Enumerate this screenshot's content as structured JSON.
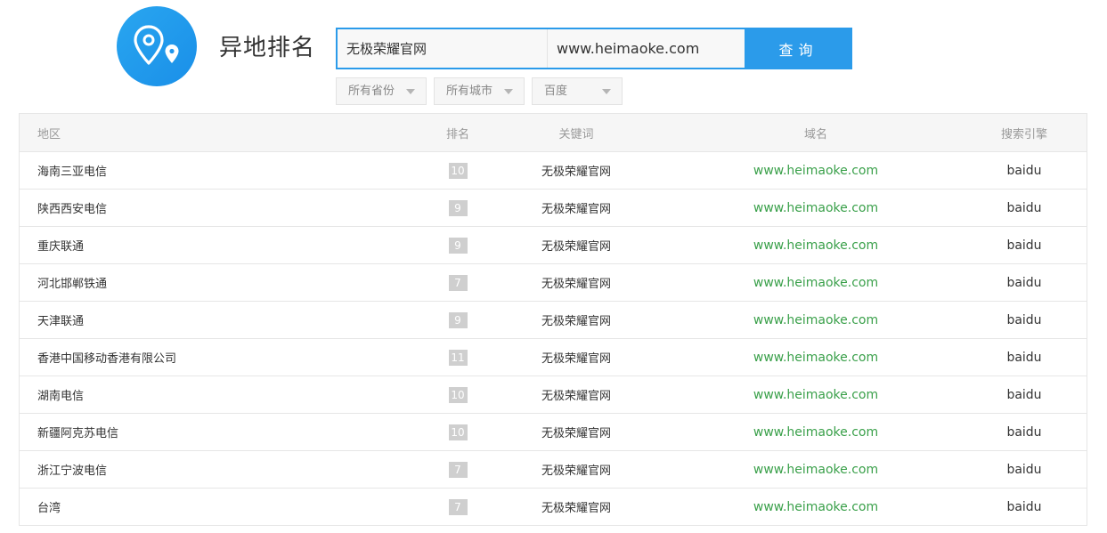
{
  "header": {
    "title": "异地排名",
    "logo_icon": "location-pins-icon",
    "accent_color": "#2b9bea"
  },
  "search": {
    "keyword_value": "无极荣耀官网",
    "domain_value": "www.heimaoke.com",
    "button_label": "查询"
  },
  "filters": {
    "province": "所有省份",
    "city": "所有城市",
    "engine": "百度"
  },
  "table": {
    "columns": [
      "地区",
      "排名",
      "关键词",
      "域名",
      "搜索引擎"
    ],
    "rows": [
      {
        "region": "海南三亚电信",
        "rank": "10",
        "keyword": "无极荣耀官网",
        "domain": "www.heimaoke.com",
        "engine": "baidu"
      },
      {
        "region": "陕西西安电信",
        "rank": "9",
        "keyword": "无极荣耀官网",
        "domain": "www.heimaoke.com",
        "engine": "baidu"
      },
      {
        "region": "重庆联通",
        "rank": "9",
        "keyword": "无极荣耀官网",
        "domain": "www.heimaoke.com",
        "engine": "baidu"
      },
      {
        "region": "河北邯郸铁通",
        "rank": "7",
        "keyword": "无极荣耀官网",
        "domain": "www.heimaoke.com",
        "engine": "baidu"
      },
      {
        "region": "天津联通",
        "rank": "9",
        "keyword": "无极荣耀官网",
        "domain": "www.heimaoke.com",
        "engine": "baidu"
      },
      {
        "region": "香港中国移动香港有限公司",
        "rank": "11",
        "keyword": "无极荣耀官网",
        "domain": "www.heimaoke.com",
        "engine": "baidu"
      },
      {
        "region": "湖南电信",
        "rank": "10",
        "keyword": "无极荣耀官网",
        "domain": "www.heimaoke.com",
        "engine": "baidu"
      },
      {
        "region": "新疆阿克苏电信",
        "rank": "10",
        "keyword": "无极荣耀官网",
        "domain": "www.heimaoke.com",
        "engine": "baidu"
      },
      {
        "region": "浙江宁波电信",
        "rank": "7",
        "keyword": "无极荣耀官网",
        "domain": "www.heimaoke.com",
        "engine": "baidu"
      },
      {
        "region": "台湾",
        "rank": "7",
        "keyword": "无极荣耀官网",
        "domain": "www.heimaoke.com",
        "engine": "baidu"
      }
    ]
  }
}
